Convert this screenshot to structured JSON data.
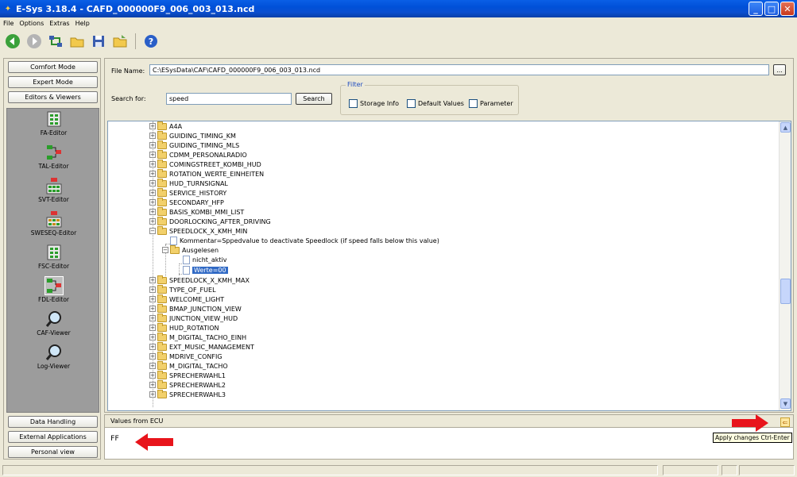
{
  "window": {
    "title": "E-Sys 3.18.4 - CAFD_000000F9_006_003_013.ncd"
  },
  "menu": [
    "File",
    "Options",
    "Extras",
    "Help"
  ],
  "left": {
    "modes": [
      "Comfort Mode",
      "Expert Mode",
      "Editors & Viewers"
    ],
    "tools": [
      "FA-Editor",
      "TAL-Editor",
      "SVT-Editor",
      "SWESEQ-Editor",
      "FSC-Editor",
      "FDL-Editor",
      "CAF-Viewer",
      "Log-Viewer"
    ],
    "bottom": [
      "Data Handling",
      "External Applications",
      "Personal view"
    ]
  },
  "form": {
    "file_label": "File Name:",
    "file_value": "C:\\ESysData\\CAF\\CAFD_000000F9_006_003_013.ncd",
    "browse_label": "...",
    "search_label": "Search for:",
    "search_value": "speed",
    "search_button": "Search",
    "filter_title": "Filter",
    "filter_storage": "Storage Info",
    "filter_default": "Default Values",
    "filter_param": "Parameter"
  },
  "tree": {
    "before": [
      "A4A",
      "GUIDING_TIMING_KM",
      "GUIDING_TIMING_MLS",
      "CDMM_PERSONALRADIO",
      "COMINGSTREET_KOMBI_HUD",
      "ROTATION_WERTE_EINHEITEN",
      "HUD_TURNSIGNAL",
      "SERVICE_HISTORY",
      "SECONDARY_HFP",
      "BASIS_KOMBI_MMI_LIST",
      "DOORLOCKING_AFTER_DRIVING"
    ],
    "open_node": "SPEEDLOCK_X_KMH_MIN",
    "kommentar": "Kommentar=Sppedvalue to deactivate Speedlock (if speed falls below this value)",
    "ausgelesen": "Ausgelesen",
    "nicht_aktiv": "nicht_aktiv",
    "werte": "Werte=00",
    "after": [
      "SPEEDLOCK_X_KMH_MAX",
      "TYPE_OF_FUEL",
      "WELCOME_LIGHT",
      "BMAP_JUNCTION_VIEW",
      "JUNCTION_VIEW_HUD",
      "HUD_ROTATION",
      "M_DIGITAL_TACHO_EINH",
      "EXT_MUSIC_MANAGEMENT",
      "MDRIVE_CONFIG",
      "M_DIGITAL_TACHO",
      "SPRECHERWAHL1",
      "SPRECHERWAHL2",
      "SPRECHERWAHL3"
    ]
  },
  "values": {
    "header": "Values from ECU",
    "content": "FF",
    "tooltip": "Apply changes  Ctrl-Enter"
  }
}
